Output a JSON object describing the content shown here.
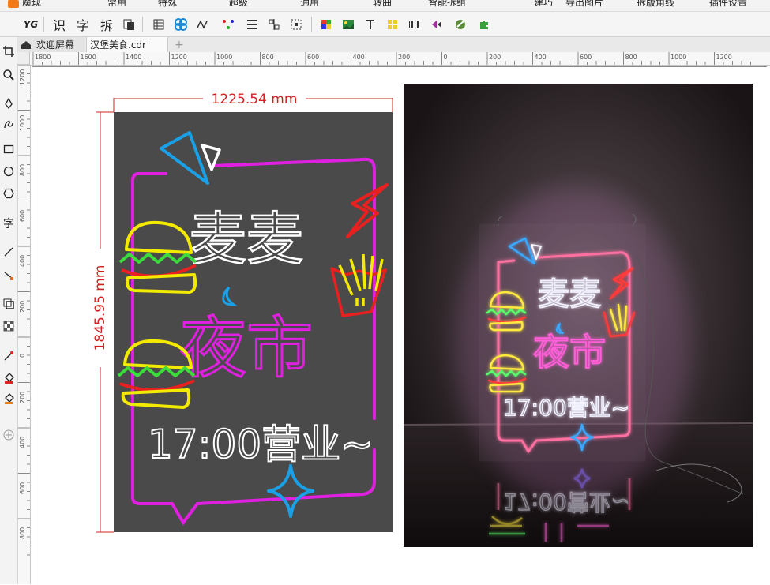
{
  "menu": {
    "items": [
      "魔现",
      "常用",
      "特殊",
      "超级",
      "通用",
      "转曲",
      "智能拆组",
      "建巧",
      "导出图片",
      "拆版角线",
      "插件设置"
    ]
  },
  "toolbar": {
    "text_buttons": [
      "识",
      "字",
      "拆"
    ]
  },
  "tabs": [
    {
      "label": "欢迎屏幕"
    },
    {
      "label": "汉堡美食.cdr"
    }
  ],
  "rulers": {
    "horizontal_ticks": [
      "1800",
      "1600",
      "1400",
      "1200",
      "1000",
      "800",
      "600",
      "400",
      "200",
      "0",
      "200",
      "400",
      "600",
      "800",
      "1000",
      "1200"
    ],
    "vertical_ticks": [
      "1200",
      "1000",
      "800",
      "600",
      "400",
      "200",
      "0",
      "200",
      "400",
      "600",
      "800"
    ]
  },
  "artwork": {
    "width_dimension": "1225.54 mm",
    "height_dimension": "1845.95 mm",
    "title_line1": "麦麦",
    "title_line2": "夜市",
    "hours": "17:00营业~"
  },
  "photo": {
    "title_line1": "麦麦",
    "title_line2": "夜市",
    "hours": "17:00营业~",
    "reflection": "17:00营业~"
  },
  "colors": {
    "dimension_red": "#d32020",
    "art_bg": "#4a4a4a",
    "neon_magenta": "#e020e0",
    "neon_yellow": "#f4ea00",
    "neon_red": "#e82020",
    "neon_blue": "#1aa0e6",
    "neon_green": "#3cdc3c"
  }
}
